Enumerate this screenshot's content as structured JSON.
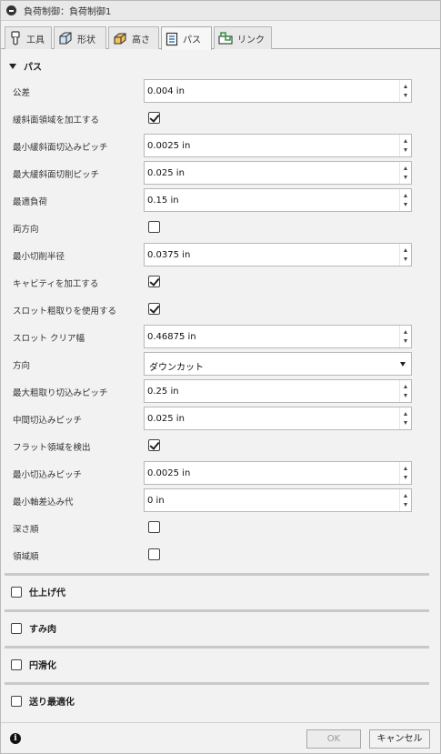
{
  "title": "負荷制御：負荷制御1",
  "tabs": [
    {
      "label": "工具",
      "icon": "tool-icon"
    },
    {
      "label": "形状",
      "icon": "geometry-icon"
    },
    {
      "label": "高さ",
      "icon": "heights-icon"
    },
    {
      "label": "パス",
      "icon": "passes-icon",
      "active": true
    },
    {
      "label": "リンク",
      "icon": "linking-icon"
    }
  ],
  "section": {
    "title": "パス",
    "expanded": true
  },
  "fields": {
    "tolerance": {
      "label": "公差",
      "value": "0.004 in"
    },
    "machine_shallow": {
      "label": "緩斜面領域を加工する",
      "checked": true
    },
    "min_shallow_stepdown": {
      "label": "最小緩斜面切込みピッチ",
      "value": "0.0025 in"
    },
    "max_shallow_stepover": {
      "label": "最大緩斜面切削ピッチ",
      "value": "0.025 in"
    },
    "optimal_load": {
      "label": "最適負荷",
      "value": "0.15 in"
    },
    "both_ways": {
      "label": "両方向",
      "checked": false
    },
    "min_cutting_radius": {
      "label": "最小切削半径",
      "value": "0.0375 in"
    },
    "machine_cavities": {
      "label": "キャビティを加工する",
      "checked": true
    },
    "use_slot_clearing": {
      "label": "スロット粗取りを使用する",
      "checked": true
    },
    "slot_clearing_width": {
      "label": "スロット クリア幅",
      "value": "0.46875 in"
    },
    "direction": {
      "label": "方向",
      "value": "ダウンカット"
    },
    "max_roughing_stepdown": {
      "label": "最大粗取り切込みピッチ",
      "value": "0.25 in"
    },
    "intermediate_stepdown": {
      "label": "中間切込みピッチ",
      "value": "0.025 in"
    },
    "detect_flat_areas": {
      "label": "フラット領域を検出",
      "checked": true
    },
    "min_stepdown": {
      "label": "最小切込みピッチ",
      "value": "0.0025 in"
    },
    "min_axial_engagement": {
      "label": "最小軸差込み代",
      "value": "0 in"
    },
    "order_by_depth": {
      "label": "深さ順",
      "checked": false
    },
    "order_by_area": {
      "label": "領域順",
      "checked": false
    }
  },
  "groups": [
    {
      "label": "仕上げ代",
      "checked": false
    },
    {
      "label": "すみ肉",
      "checked": false
    },
    {
      "label": "円滑化",
      "checked": false
    },
    {
      "label": "送り最適化",
      "checked": false
    }
  ],
  "footer": {
    "info_glyph": "i",
    "ok_label": "OK",
    "cancel_label": "キャンセル",
    "ok_enabled": false
  }
}
